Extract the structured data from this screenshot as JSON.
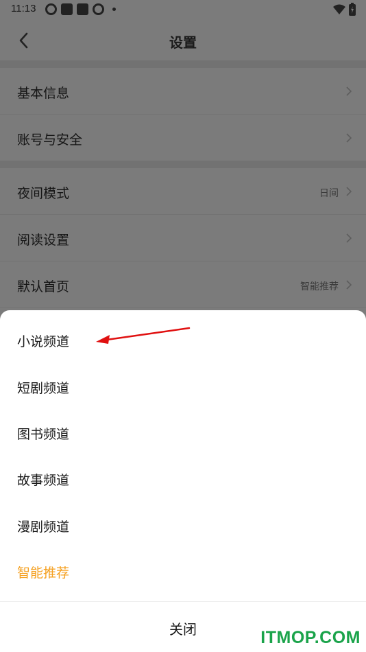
{
  "status_bar": {
    "time": "11:13"
  },
  "nav": {
    "title": "设置"
  },
  "settings": {
    "group1": [
      {
        "label": "基本信息",
        "value": ""
      },
      {
        "label": "账号与安全",
        "value": ""
      }
    ],
    "group2": [
      {
        "label": "夜间模式",
        "value": "日间"
      },
      {
        "label": "阅读设置",
        "value": ""
      },
      {
        "label": "默认首页",
        "value": "智能推荐"
      }
    ]
  },
  "sheet": {
    "options": [
      {
        "label": "小说频道"
      },
      {
        "label": "短剧频道"
      },
      {
        "label": "图书频道"
      },
      {
        "label": "故事频道"
      },
      {
        "label": "漫剧频道"
      },
      {
        "label": "智能推荐",
        "selected": true
      }
    ],
    "close_label": "关闭"
  },
  "watermark": "ITMOP.COM",
  "colors": {
    "accent": "#f5a020",
    "arrow": "#e01010",
    "watermark": "#1aa34a"
  }
}
